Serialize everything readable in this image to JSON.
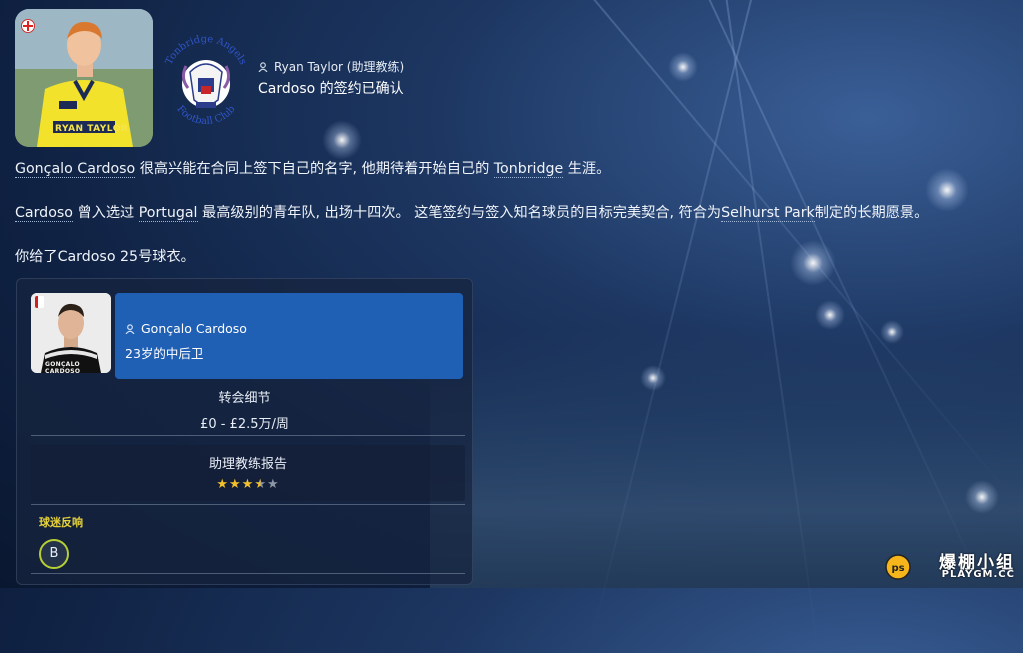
{
  "news": {
    "reporter_name": "Ryan Taylor (助理教练)",
    "headline": "Cardoso 的签约已确认",
    "header_photo_caption": "RYAN TAYLOR"
  },
  "club": {
    "crest_text_top": "Tonbridge Angels",
    "crest_text_bottom": "Football Club"
  },
  "article": {
    "p1": {
      "link_player": "Gonçalo Cardoso",
      "text_a": " 很高兴能在合同上签下自己的名字, 他期待着开始自己的 ",
      "link_club": "Tonbridge",
      "text_b": " 生涯。"
    },
    "p2": {
      "link_player": "Cardoso",
      "text_a": " 曾入选过 ",
      "link_nation": "Portugal",
      "text_b": " 最高级别的青年队, 出场十四次。 这笔签约与签入知名球员的目标完美契合, 符合为",
      "link_stadium": "Selhurst Park",
      "text_c": "制定的长期愿景。"
    },
    "p3": {
      "text": "你给了Cardoso 25号球衣。"
    }
  },
  "player_card": {
    "name": "Gonçalo Cardoso",
    "description": "23岁的中后卫",
    "photo_caption": "GONÇALO CARDOSO",
    "contract_title": "转会细节",
    "contract_value": "£0 - £2.5万/周",
    "report_title": "助理教练报告",
    "rating_stars": 3.5,
    "rating_max": 5,
    "fan_reaction_label": "球迷反响",
    "fan_reaction_grade": "B"
  },
  "watermark": {
    "brand_cn": "爆棚小组",
    "brand_url": "PLAYGM.CC",
    "logo_text": "ps"
  },
  "colors": {
    "accent_panel": "#1f5fb4",
    "star": "#f3c12b",
    "fan_badge_ring": "#b6cf35"
  }
}
